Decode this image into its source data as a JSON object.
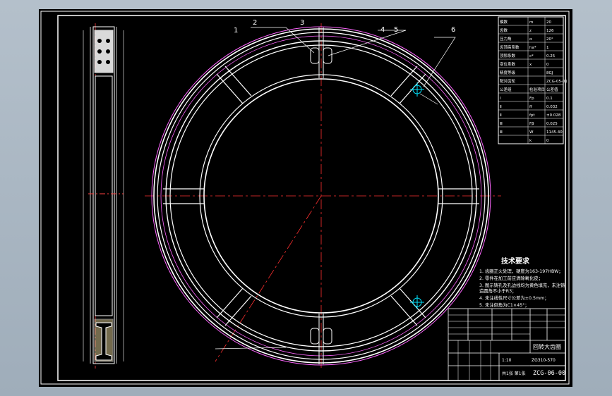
{
  "drawing": {
    "tech_req_title": "技术要求",
    "tech_req_lines": [
      "1. 齿圈正火处理，硬度为163-197HBW；",
      "2. 零件在加工前应清除氧化皮；",
      "3. 图示铸孔及孔边线均为黄色填充，未注铸",
      "   造圆角不小于R3；",
      "4. 未注线性尺寸公差为±0.5mm；",
      "5. 未注倒角为C1×45°；"
    ],
    "drawing_no": "ZCG-06-00",
    "part_title": "回转大齿圈",
    "balloons": [
      "1",
      "2",
      "3",
      "4",
      "5",
      "6"
    ],
    "param_table": [
      [
        "模数",
        "m",
        "20"
      ],
      [
        "齿数",
        "z",
        "126"
      ],
      [
        "压力角",
        "α",
        "20°"
      ],
      [
        "齿顶高系数",
        "ha*",
        "1"
      ],
      [
        "顶隙系数",
        "c*",
        "0.25"
      ],
      [
        "变位系数",
        "x",
        "0"
      ],
      [
        "精度等级",
        "",
        "8GJ"
      ],
      [
        "配对齿轮",
        "",
        "ZCG-05-01"
      ],
      [
        "公差组",
        "检验项目",
        "公差值"
      ],
      [
        "Ⅰ",
        "Fp",
        "0.1"
      ],
      [
        "Ⅱ",
        "ff",
        "0.032"
      ],
      [
        "Ⅱ",
        "fpt",
        "±0.028"
      ],
      [
        "Ⅲ",
        "Fβ",
        "0.025"
      ],
      [
        "Ⅲ",
        "W",
        "1145.40"
      ],
      [
        "",
        "k",
        "0"
      ]
    ],
    "title_block": {
      "company": "",
      "scale": "1:10",
      "sheet": "共1张 第1张",
      "material": "ZG310-570",
      "weight": ""
    }
  }
}
